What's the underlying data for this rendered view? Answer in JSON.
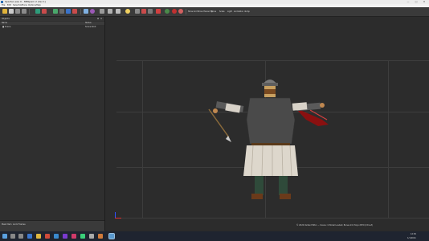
{
  "window": {
    "title": "Spartan.exe 0 - MBSpam 2 (Ver 1)",
    "controls": [
      "—",
      "□",
      "✕"
    ]
  },
  "menu": [
    "File",
    "Edit",
    "Selection",
    "Trans",
    "Options",
    "Help"
  ],
  "toolbar": {
    "labels": [
      "Show Grd",
      "Show Hierarchy",
      "Bone",
      "Scale",
      "Light",
      "Animation dump"
    ]
  },
  "left_panel": {
    "title": "Objects",
    "columns": [
      "Name",
      "Status"
    ],
    "rows": [
      {
        "name": "■ Scene",
        "status": "Scene Root"
      }
    ],
    "footer": [
      "Mesh Item",
      "Anim Frames"
    ]
  },
  "viewport": {
    "status_text": "© 2020 Vertex Editor — Scene: 1 Model Loaded; Bones 24; Polys 2870 (Ctrl+Z)"
  },
  "taskbar": {
    "time": "12:30",
    "date": "1/1/2021"
  },
  "colors": {
    "titlebar": "#ececec",
    "toolbar": "#3a3a3a",
    "panel": "#2f2f2f",
    "viewport": "#2c2c2c",
    "taskbar": "#1f2430"
  }
}
